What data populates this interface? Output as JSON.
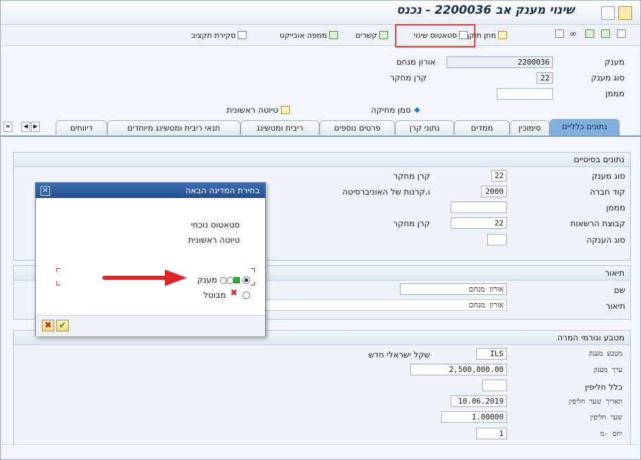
{
  "window": {
    "title": "שינוי מענק אב 2200036 - נכנס"
  },
  "toolbar": {
    "items": [
      {
        "label": "מתן תוקף"
      },
      {
        "label": "סטאטוס שינוי"
      },
      {
        "label": "קשרים"
      },
      {
        "label": "ממפה אובייקט"
      },
      {
        "label": "סקירת תקציב"
      }
    ]
  },
  "header": {
    "grant_label": "מענק",
    "grant_value": "2200036",
    "grant_desc": "אורון מנחם",
    "grant_type_label": "סוג מענק",
    "grant_type_value": "22",
    "grant_type_desc": "קרן מחקר",
    "sponsor_label": "מממן",
    "sponsor_value": "",
    "status_label": "סמן מחיקה",
    "draft_label": "טיוטה ראשונית"
  },
  "tabs": [
    "נתונים כלליים",
    "סימוכין",
    "ממדים",
    "נתוני קרן",
    "פרטים נוספים",
    "ריבית ומטשינג",
    "תנאי ריבית ומטשינג מיוחדים",
    "דיווחים"
  ],
  "basic": {
    "title": "נתונים בסיסיים",
    "rows": [
      {
        "label": "סוג מענק",
        "value": "22",
        "desc": "קרן מחקר"
      },
      {
        "label": "קוד חברה",
        "value": "2000",
        "desc": "ו.קרנות של האוניברסיטה"
      },
      {
        "label": "מממן",
        "value": "",
        "desc": ""
      },
      {
        "label": "קבוצת הרשאות",
        "value": "22",
        "desc": "קרן מחקר"
      },
      {
        "label": "סוג הענקה",
        "value": "",
        "desc": ""
      }
    ]
  },
  "description": {
    "title": "תיאור",
    "name_label": "שם",
    "name_value": "אורון מנחם",
    "desc_label": "תיאור",
    "desc_value": "אורון מנחם"
  },
  "currency": {
    "title": "מטבע וגורמי המרה",
    "rows": [
      {
        "label": "מטבע מענק",
        "value": "ILS",
        "desc": "שקל ישראלי חדש"
      },
      {
        "label": "ערך מענק",
        "value": "2,500,000.00",
        "desc": ""
      },
      {
        "label": "כלל חליפין",
        "value": "",
        "desc": ""
      },
      {
        "label": "תאריך שער חליפין",
        "value": "10.06.2019",
        "desc": ""
      },
      {
        "label": "שער חליפין",
        "value": "1.00000",
        "desc": ""
      },
      {
        "label": "יחס -מ",
        "value": "1",
        "desc": ""
      }
    ]
  },
  "dialog": {
    "title": "בחירת המדינה הבאה",
    "current_status_label": "סטאטוס נוכחי",
    "current_status_value": "טיוטה ראשונית",
    "options": [
      {
        "label": "מענק",
        "selected": true
      },
      {
        "label": "מבוטל",
        "selected": false
      }
    ],
    "cancel_symbol": "✖",
    "confirm_symbol": "✔"
  },
  "colors": {
    "accent": "#e23b3b",
    "tab_active": "#7fb0de",
    "dialog_title": "#2a5a9c"
  }
}
